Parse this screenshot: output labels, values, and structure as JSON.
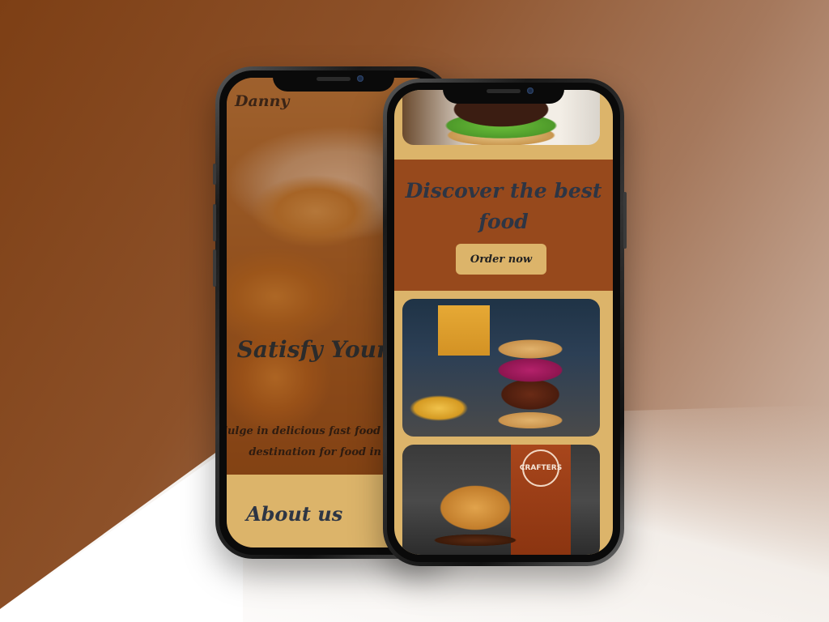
{
  "left_phone": {
    "brand": "Danny",
    "hero_title": "Satisfy Your Cravings",
    "hero_text": "Indulge in delicious fast food at the ultimate destination for food in Algeria.",
    "about_title": "About us"
  },
  "right_phone": {
    "promo_title": "Discover the best food",
    "order_button": "Order now",
    "glass_logo_text": "CRAFTERS"
  },
  "colors": {
    "brown_primary": "#97491c",
    "gold_accent": "#dcb46a",
    "heading_dark": "#2d3544"
  }
}
